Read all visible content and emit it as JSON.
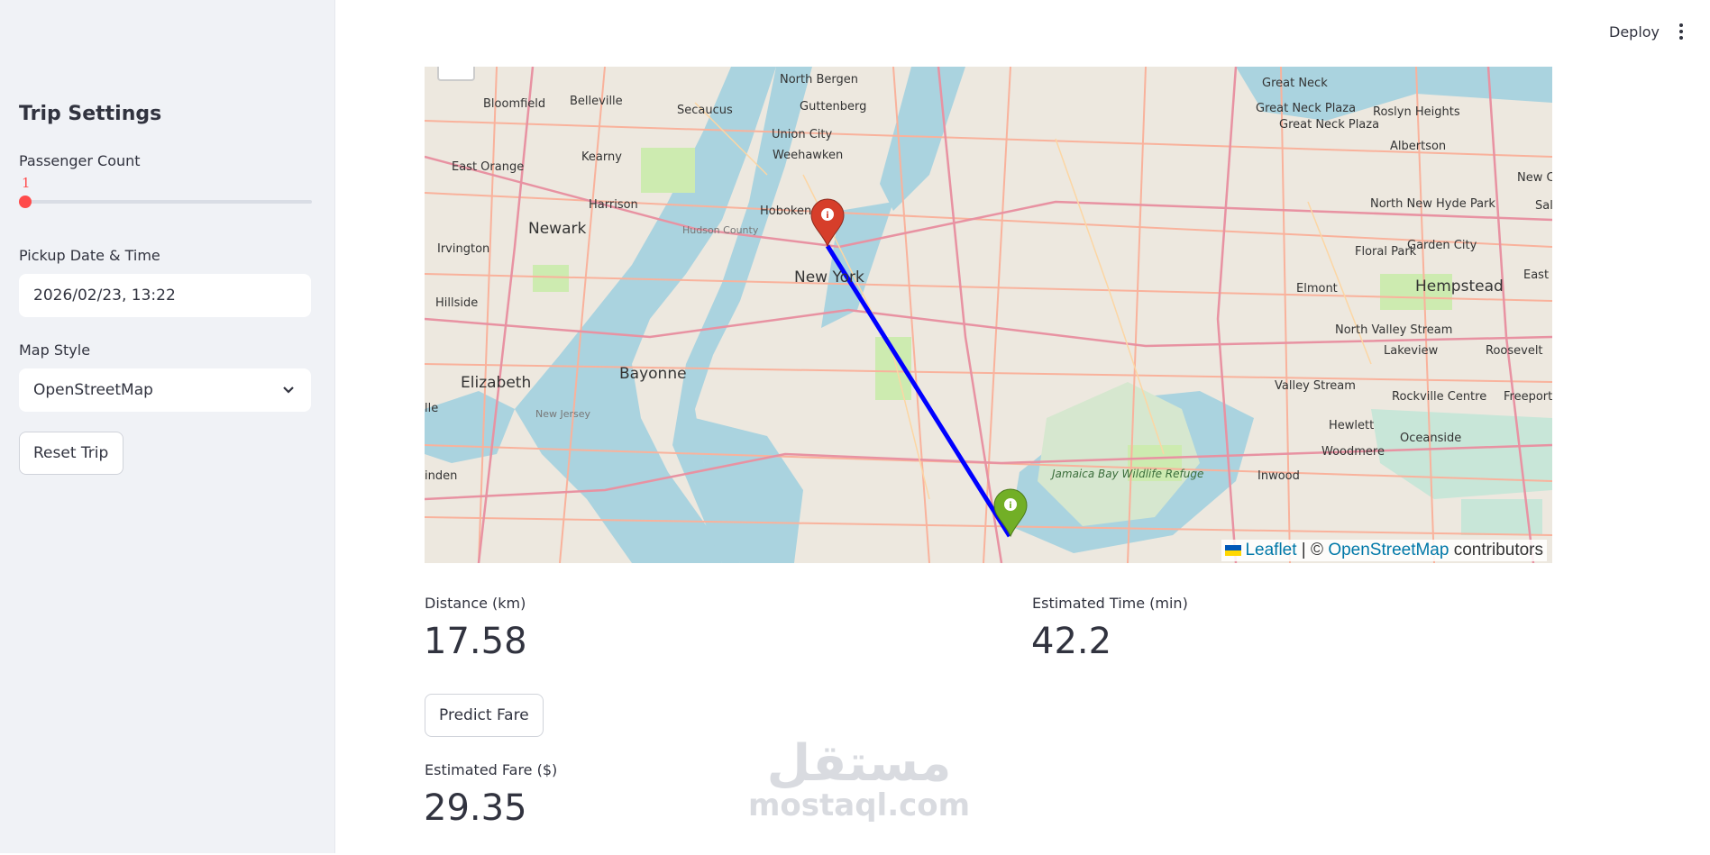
{
  "sidebar": {
    "title": "Trip Settings",
    "passenger": {
      "label": "Passenger Count",
      "value": "1"
    },
    "pickup": {
      "label": "Pickup Date & Time",
      "value": "2026/02/23, 13:22"
    },
    "map_style": {
      "label": "Map Style",
      "value": "OpenStreetMap"
    },
    "reset_label": "Reset Trip"
  },
  "header": {
    "deploy_label": "Deploy"
  },
  "map": {
    "places": {
      "north_bergen": "North Bergen",
      "guttenberg": "Guttenberg",
      "great_neck": "Great Neck",
      "great_neck_plaza": "Great Neck Plaza",
      "roslyn_heights": "Roslyn Heights",
      "albertson": "Albertson",
      "bloomfield": "Bloomfield",
      "belleville": "Belleville",
      "secaucus": "Secaucus",
      "union_city": "Union City",
      "weehawken": "Weehawken",
      "east_orange": "East Orange",
      "kearny": "Kearny",
      "harrison": "Harrison",
      "hoboken": "Hoboken",
      "newark": "Newark",
      "hudson_county": "Hudson County",
      "new_york": "New York",
      "irvington": "Irvington",
      "hillside": "Hillside",
      "north_new_hyde_park": "North New Hyde Park",
      "floral_park": "Floral Park",
      "garden_city": "Garden City",
      "new_c": "New C",
      "sal": "Sal",
      "elmont": "Elmont",
      "hempstead": "Hempstead",
      "east": "East",
      "north_valley_stream": "North Valley Stream",
      "lakeview": "Lakeview",
      "roosevelt": "Roosevelt",
      "elizabeth": "Elizabeth",
      "bayonne": "Bayonne",
      "valley_stream": "Valley Stream",
      "rockville_centre": "Rockville Centre",
      "freeport": "Freeport",
      "new_jersey": "New Jersey",
      "hewlett": "Hewlett",
      "oceanside": "Oceanside",
      "woodmere": "Woodmere",
      "inwood": "Inwood",
      "lle": "lle",
      "linden": "inden",
      "jamaica_bay": "Jamaica Bay Wildlife Refuge"
    },
    "attribution": {
      "leaflet": "Leaflet",
      "sep": " | © ",
      "osm": "OpenStreetMap",
      "rest": " contributors"
    },
    "colors": {
      "route": "#0000ff",
      "pickup_marker": "#d63e2a",
      "dropoff_marker": "#72af26"
    }
  },
  "metrics": {
    "distance": {
      "label": "Distance (km)",
      "value": "17.58"
    },
    "time": {
      "label": "Estimated Time (min)",
      "value": "42.2"
    },
    "fare": {
      "label": "Estimated Fare ($)",
      "value": "29.35"
    }
  },
  "predict_label": "Predict Fare",
  "watermark": {
    "arabic": "مستقل",
    "latin": "mostaql.com"
  }
}
